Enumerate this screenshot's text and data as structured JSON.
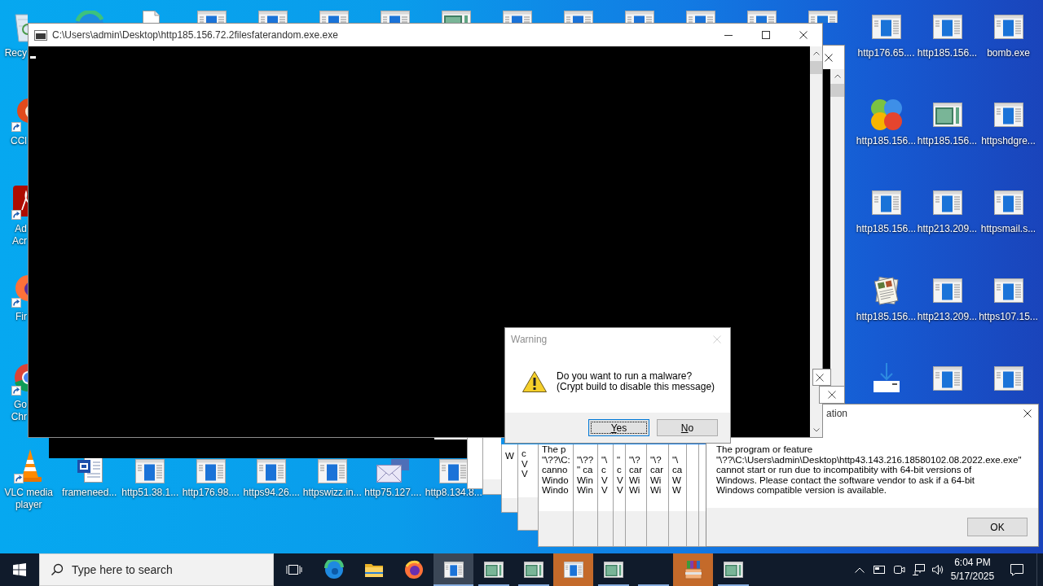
{
  "desktop": {
    "left_column": [
      {
        "kind": "recycle-bin",
        "label": "Recy"
      },
      {
        "kind": "cleaner",
        "label": "CCl"
      },
      {
        "kind": "pdf-reader",
        "label": "Ad Acr"
      },
      {
        "kind": "fox-browser",
        "label": "Fir"
      },
      {
        "kind": "chrome-browser",
        "label": "Go Chr"
      }
    ],
    "top_row": [
      {
        "kind": "browser"
      },
      {
        "kind": "file"
      },
      {
        "kind": "program"
      },
      {
        "kind": "program"
      },
      {
        "kind": "program"
      },
      {
        "kind": "program"
      },
      {
        "kind": "image-program"
      },
      {
        "kind": "program"
      },
      {
        "kind": "program"
      },
      {
        "kind": "program"
      },
      {
        "kind": "program"
      },
      {
        "kind": "program"
      },
      {
        "kind": "program"
      }
    ],
    "right_grid": [
      {
        "kind": "program",
        "label": "http176.65...."
      },
      {
        "kind": "program",
        "label": "http185.156..."
      },
      {
        "kind": "program",
        "label": "bomb.exe"
      },
      {
        "kind": "circles",
        "label": "http185.156..."
      },
      {
        "kind": "image-program",
        "label": "http185.156..."
      },
      {
        "kind": "program",
        "label": "httpshdgre..."
      },
      {
        "kind": "program",
        "label": "http185.156..."
      },
      {
        "kind": "program",
        "label": "http213.209..."
      },
      {
        "kind": "program",
        "label": "httpsmail.s..."
      },
      {
        "kind": "papers",
        "label": "http185.156..."
      },
      {
        "kind": "program",
        "label": "http213.209..."
      },
      {
        "kind": "program",
        "label": "https107.15..."
      },
      {
        "kind": "download"
      },
      {
        "kind": "program"
      },
      {
        "kind": "program"
      }
    ],
    "bottom_row": [
      {
        "kind": "cone",
        "label": "VLC media player"
      },
      {
        "kind": "word-document",
        "label": "frameneed..."
      },
      {
        "kind": "program",
        "label": "http51.38.1..."
      },
      {
        "kind": "program",
        "label": "http176.98...."
      },
      {
        "kind": "program",
        "label": "https94.26...."
      },
      {
        "kind": "program",
        "label": "httpswizz.in..."
      },
      {
        "kind": "mail",
        "label": "http75.127...."
      },
      {
        "kind": "program",
        "label": "http8.134.8..."
      }
    ]
  },
  "console_window": {
    "title": "C:\\Users\\admin\\Desktop\\http185.156.72.2filesfaterandom.exe.exe"
  },
  "error_dialogs": {
    "stacked": [
      {
        "kind": "plain"
      },
      {
        "kind": "dialog"
      },
      {
        "kind": "dialog",
        "text": "W"
      },
      {
        "kind": "dialog",
        "text": "c\nV\nV"
      },
      {
        "kind": "dialog",
        "text": "The p\n\"\\??\\C:\ncanno\nWindo\nWindo"
      },
      {
        "kind": "dialog",
        "text": "\"\\??\n\" ca\nWin\nWin"
      },
      {
        "kind": "dialog",
        "text": "\"\\\nc\nV\nV"
      },
      {
        "kind": "dialog",
        "text": "\"\nc\nV\nV"
      },
      {
        "kind": "dialog",
        "text": "\"\\?\ncar\nWi\nWi"
      },
      {
        "kind": "dialog",
        "text": "\"\\?\ncar\nWi\nWi"
      },
      {
        "kind": "dialog",
        "text": "\"\\\nca\nW\nW"
      },
      {
        "kind": "dialog"
      },
      {
        "kind": "dialog"
      }
    ],
    "front": {
      "title": "ation",
      "message": "The program or feature\n\"\\??\\C:\\Users\\admin\\Desktop\\http43.143.216.18580102.08.2022.exe.exe\"\ncannot start or run due to incompatibity with 64-bit versions of\nWindows. Please contact the software vendor to ask if a 64-bit\nWindows compatible version is available.",
      "button": "OK"
    }
  },
  "warning_dialog": {
    "title": "Warning",
    "message": "Do you want to run a malware?\n(Crypt build to disable this message)",
    "buttons": [
      {
        "label": "Yes",
        "focused": true
      },
      {
        "label": "No",
        "focused": false
      }
    ]
  },
  "taskbar": {
    "search": {
      "placeholder": "Type here to search"
    },
    "pinned": [
      {
        "kind": "task-view"
      },
      {
        "kind": "edge"
      },
      {
        "kind": "folder"
      },
      {
        "kind": "firefox"
      }
    ],
    "running": [
      {
        "kind": "program",
        "active": true,
        "flashing": false
      },
      {
        "kind": "image-program",
        "active": false,
        "flashing": false
      },
      {
        "kind": "image-program",
        "active": false,
        "flashing": false
      },
      {
        "kind": "program",
        "active": false,
        "flashing": true
      },
      {
        "kind": "image-program",
        "active": false,
        "flashing": false
      },
      {
        "kind": "blank",
        "active": false,
        "flashing": false
      },
      {
        "kind": "books",
        "active": false,
        "flashing": true
      },
      {
        "kind": "image-program",
        "active": false,
        "flashing": false
      }
    ],
    "clock": {
      "time": "6:04 PM",
      "date": "5/17/2025"
    }
  }
}
